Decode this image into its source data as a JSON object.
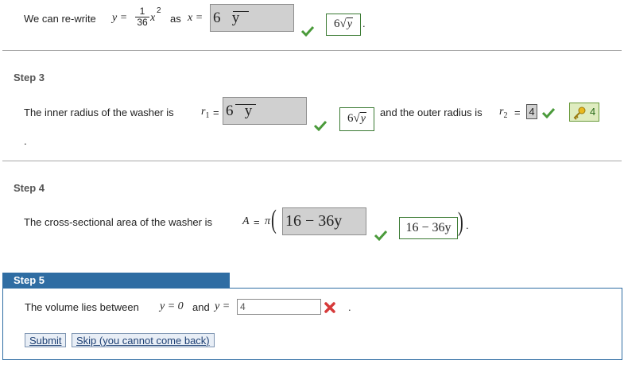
{
  "step2": {
    "lead": "We can re-write",
    "eq_y": "y =",
    "frac_num": "1",
    "frac_den": "36",
    "eq_rest": "x",
    "exp": "2",
    "as": "as",
    "eq_x": "x =",
    "answer_input": "6   y",
    "answer_correct_coef": "6",
    "answer_correct_rad": "y"
  },
  "step3": {
    "heading": "Step 3",
    "text1": "The inner radius of the washer is",
    "r1_label": "r",
    "r1_sub": "1",
    "eq": "=",
    "inner_input": "6   y",
    "inner_correct_coef": "6",
    "inner_correct_rad": "y",
    "text2": "and the outer radius is",
    "r2_label": "r",
    "r2_sub": "2",
    "outer_input": "4",
    "outer_key_value": "4",
    "trailing": "."
  },
  "step4": {
    "heading": "Step 4",
    "text": "The cross-sectional area of the washer is",
    "A": "A",
    "eq": "=",
    "pi": "π",
    "area_input": "16 − 36y",
    "area_correct": "16 − 36y"
  },
  "step5": {
    "heading": "Step 5",
    "text1": "The volume lies between",
    "y0": "y = 0",
    "and": "and",
    "y_eq": "y =",
    "input_value": "4",
    "period": ".",
    "submit": "Submit",
    "skip": "Skip (you cannot come back)"
  },
  "colors": {
    "correct": "#4a9a3a",
    "wrong": "#d63a3a",
    "step_bar": "#2f6da3",
    "key_box": "#dfecc0"
  },
  "icons": {
    "check": "check-icon",
    "cross": "x-icon",
    "key": "key-icon"
  }
}
